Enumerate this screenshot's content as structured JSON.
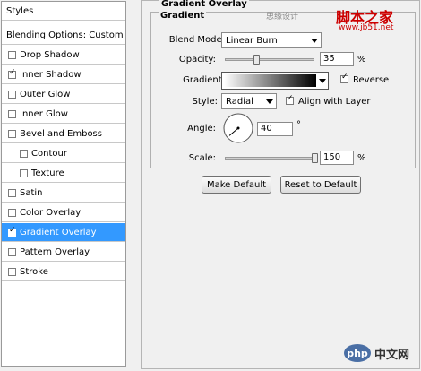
{
  "left_panel": {
    "header": "Styles",
    "blending_options": "Blending Options: Custom",
    "items": [
      {
        "label": "Drop Shadow",
        "checked": false,
        "selected": false,
        "indent": false
      },
      {
        "label": "Inner Shadow",
        "checked": true,
        "selected": false,
        "indent": false
      },
      {
        "label": "Outer Glow",
        "checked": false,
        "selected": false,
        "indent": false
      },
      {
        "label": "Inner Glow",
        "checked": false,
        "selected": false,
        "indent": false
      },
      {
        "label": "Bevel and Emboss",
        "checked": false,
        "selected": false,
        "indent": false
      },
      {
        "label": "Contour",
        "checked": false,
        "selected": false,
        "indent": true
      },
      {
        "label": "Texture",
        "checked": false,
        "selected": false,
        "indent": true
      },
      {
        "label": "Satin",
        "checked": false,
        "selected": false,
        "indent": false
      },
      {
        "label": "Color Overlay",
        "checked": false,
        "selected": false,
        "indent": false
      },
      {
        "label": "Gradient Overlay",
        "checked": true,
        "selected": true,
        "indent": false
      },
      {
        "label": "Pattern Overlay",
        "checked": false,
        "selected": false,
        "indent": false
      },
      {
        "label": "Stroke",
        "checked": false,
        "selected": false,
        "indent": false
      }
    ]
  },
  "right_panel": {
    "section_title": "Gradient Overlay",
    "group_title": "Gradient",
    "blend_mode": {
      "label": "Blend Mode:",
      "value": "Linear Burn"
    },
    "opacity": {
      "label": "Opacity:",
      "value": "35",
      "unit": "%",
      "level": 0.35
    },
    "gradient": {
      "label": "Gradient:",
      "reverse_label": "Reverse",
      "reverse_checked": true
    },
    "style": {
      "label": "Style:",
      "value": "Radial",
      "align_label": "Align with Layer",
      "align_checked": true
    },
    "angle": {
      "label": "Angle:",
      "value": "40",
      "unit": "°"
    },
    "scale": {
      "label": "Scale:",
      "value": "150",
      "unit": "%",
      "level": 1.0
    },
    "make_default": "Make Default",
    "reset_default": "Reset to Default"
  },
  "watermarks": {
    "top_text": "思缘设计",
    "top_brand": "脚本之家",
    "top_url": "www.jb51.net",
    "bottom_logo": "php",
    "bottom_text": "中文网"
  },
  "colors": {
    "selection": "#3399ff",
    "watermark_red": "#cc0000"
  }
}
